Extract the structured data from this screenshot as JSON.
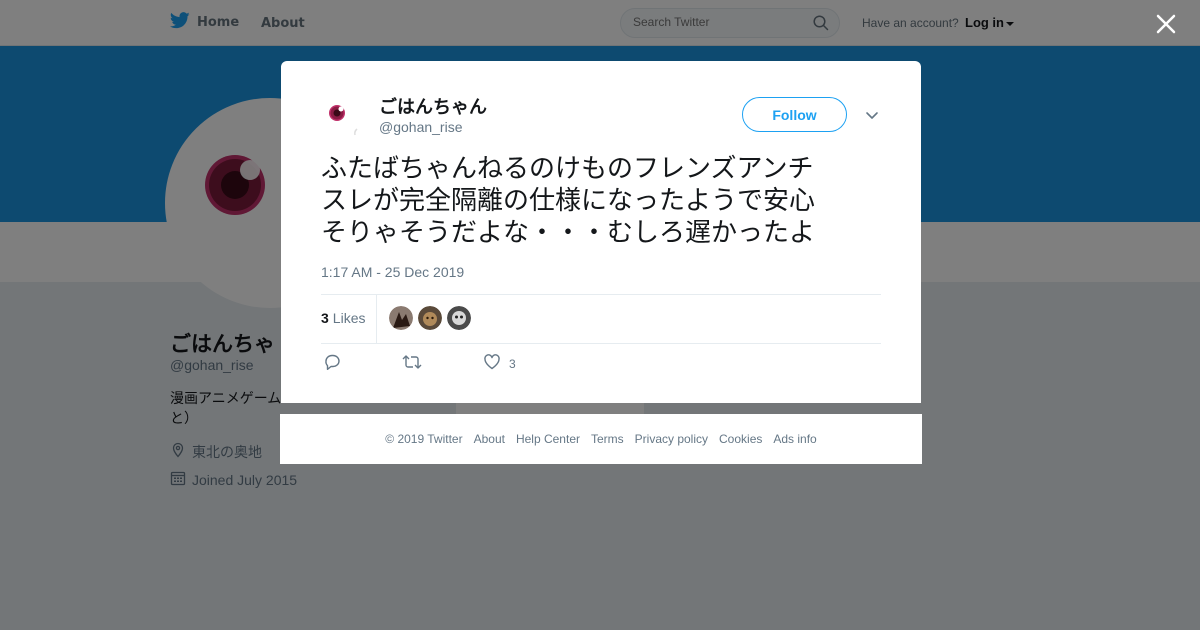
{
  "nav": {
    "home_label": "Home",
    "about_label": "About",
    "search_placeholder": "Search Twitter",
    "account_prompt": "Have an account?",
    "login_label": "Log in"
  },
  "profile": {
    "name": "ごはんちゃ",
    "handle": "@gohan_rise",
    "bio_line1": "漫画アニメゲーム",
    "bio_line2": "と）",
    "location": "東北の奥地",
    "joined": "Joined July 2015"
  },
  "tweet": {
    "author_name": "ごはんちゃん",
    "author_handle": "@gohan_rise",
    "follow_label": "Follow",
    "text_lines": [
      "ふたばちゃんねるのけものフレンズアンチ",
      "スレが完全隔離の仕様になったようで安心",
      "そりゃそうだよな・・・むしろ遅かったよ"
    ],
    "timestamp": "1:17 AM - 25 Dec 2019",
    "likes_count": "3",
    "likes_label": "Likes",
    "like_action_count": "3"
  },
  "footer": {
    "links": [
      "© 2019 Twitter",
      "About",
      "Help Center",
      "Terms",
      "Privacy policy",
      "Cookies",
      "Ads info"
    ]
  },
  "colors": {
    "brand_blue": "#1da1f2",
    "banner_blue": "#1b95e0",
    "avatar_eye": "#c0306a"
  }
}
